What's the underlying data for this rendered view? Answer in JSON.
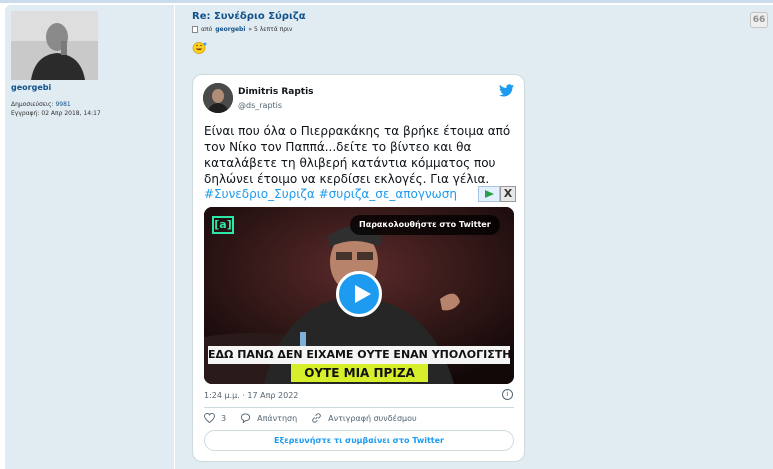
{
  "profile": {
    "username": "georgebi",
    "posts_label": "Δημοσιεύσεις:",
    "posts_value": "9981",
    "registered_label": "Εγγραφή:",
    "registered_value": "02 Απρ 2018, 14:17"
  },
  "post": {
    "title": "Re: Συνέδριο Σύριζα",
    "author_prefix": "από",
    "author": "georgebi",
    "time_suffix": "» 5 λεπτά πριν",
    "quote_label": "66",
    "smiley_icon": "laughing-smiley-icon"
  },
  "tweet": {
    "name": "Dimitris Raptis",
    "handle": "@ds_raptis",
    "text": "Είναι που όλα ο Πιερρακάκης τα βρήκε έτοιμα από τον Νίκο τον Παππά...δείτε το βίντεο και θα καταλάβετε τη θλιβερή κατάντια κόμματος που δηλώνει έτοιμο να κερδίσει εκλογές. Για γέλια.",
    "hashtags": "#Συνεδριο_Συριζα #συριζα_σε_απογνωση",
    "watch_label": "Παρακολουθήστε στο Twitter",
    "video_logo": "[a]",
    "subtitle_line1": "ΕΔΩ ΠΑΝΩ ΔΕΝ ΕΙΧΑΜΕ ΟΥΤΕ ΕΝΑΝ ΥΠΟΛΟΓΙΣΤΗ",
    "subtitle_line2": "ΟΥΤΕ ΜΙΑ ΠΡΙΖΑ",
    "timestamp": "1:24 μ.μ. · 17 Απρ 2022",
    "likes": "3",
    "reply_label": "Απάντηση",
    "copy_link_label": "Αντιγραφή συνδέσμου",
    "explore_label": "Εξερευνήστε τι συμβαίνει στο Twitter",
    "info_label": "i",
    "ad_close": "X",
    "accent_color": "#1d9bf0",
    "subtitle_highlight": "#d6ef2a"
  }
}
